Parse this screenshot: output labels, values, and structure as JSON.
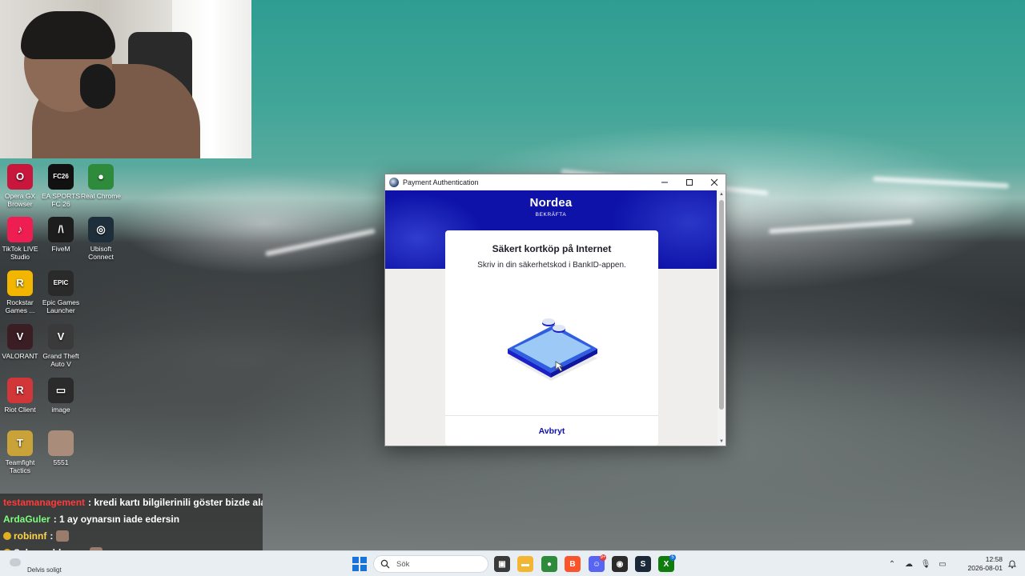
{
  "desktop": {
    "icons": [
      {
        "label": "Opera GX Browser",
        "name": "opera-gx-icon",
        "color": "#c8163c",
        "glyph": "O"
      },
      {
        "label": "EA SPORTS FC 26",
        "name": "ea-fc-icon",
        "color": "#111111",
        "glyph": "FC26"
      },
      {
        "label": "Real Chrome",
        "name": "chrome-icon",
        "color": "#2e8b3b",
        "glyph": "●"
      },
      {
        "label": "TikTok LIVE Studio",
        "name": "tiktok-icon",
        "color": "#ee1d52",
        "glyph": "♪"
      },
      {
        "label": "FiveM",
        "name": "fivem-icon",
        "color": "#1d1d1d",
        "glyph": "/\\"
      },
      {
        "label": "Ubisoft Connect",
        "name": "ubisoft-icon",
        "color": "#1f2e3b",
        "glyph": "◎"
      },
      {
        "label": "Rockstar Games ...",
        "name": "rockstar-icon",
        "color": "#f2b600",
        "glyph": "R"
      },
      {
        "label": "Epic Games Launcher",
        "name": "epic-games-icon",
        "color": "#2a2a2a",
        "glyph": "EPIC"
      },
      {
        "label": "VALORANT",
        "name": "valorant-icon",
        "color": "#3b1d24",
        "glyph": "V"
      },
      {
        "label": "Grand Theft Auto V",
        "name": "gta5-icon",
        "color": "#3a3a3a",
        "glyph": "V"
      },
      {
        "label": "Riot Client",
        "name": "riot-client-icon",
        "color": "#d13639",
        "glyph": "R"
      },
      {
        "label": "image",
        "name": "image-file-icon",
        "color": "#2b2b2b",
        "glyph": "▭"
      },
      {
        "label": "Teamfight Tactics",
        "name": "tft-icon",
        "color": "#caa23a",
        "glyph": "T"
      },
      {
        "label": "5551",
        "name": "photo-file-icon",
        "color": "#a98c79",
        "glyph": ""
      }
    ]
  },
  "chat": {
    "messages": [
      {
        "user": "testamanagement",
        "text": ": kredi kartı bilgilerinili göster bizde alak",
        "color": "#ff3b3b"
      },
      {
        "user": "ArdaGuler",
        "text": ": 1 ay oynarsın iade edersin",
        "color": "#7cff7c"
      },
      {
        "user": "robinnf",
        "text": ":",
        "color": "#ffd54a"
      },
      {
        "user": "Schwarzbleurr",
        "text": ":",
        "color": "#ffffff"
      }
    ]
  },
  "dialog": {
    "title": "Payment Authentication",
    "brand": "Nordea",
    "brand_sub": "BEKRÄFTA",
    "heading": "Säkert kortköp på Internet",
    "instruction": "Skriv in din säkerhetskod i BankID-appen.",
    "cancel_label": "Avbryt",
    "brand_color": "#0e12a8"
  },
  "taskbar": {
    "weather_text": "Delvis soligt",
    "search_placeholder": "Sök",
    "apps": [
      {
        "name": "task-view-icon",
        "color": "#3a3a3a",
        "glyph": "▣",
        "badge": ""
      },
      {
        "name": "file-explorer-icon",
        "color": "#f2b632",
        "glyph": "▬",
        "badge": ""
      },
      {
        "name": "chrome-taskbar-icon",
        "color": "#2e8b3b",
        "glyph": "●",
        "badge": ""
      },
      {
        "name": "brave-icon",
        "color": "#fb542b",
        "glyph": "B",
        "badge": ""
      },
      {
        "name": "discord-icon",
        "color": "#5865f2",
        "glyph": "☺",
        "badge": "9+"
      },
      {
        "name": "obs-icon",
        "color": "#2b2b2b",
        "glyph": "◉",
        "badge": ""
      },
      {
        "name": "steam-icon",
        "color": "#1b2838",
        "glyph": "S",
        "badge": ""
      },
      {
        "name": "xbox-icon",
        "color": "#107c10",
        "glyph": "X",
        "badge": "5"
      }
    ],
    "tray": [
      {
        "name": "chevron-up-icon",
        "glyph": "⌃"
      },
      {
        "name": "cloud-off-icon",
        "glyph": "☁"
      },
      {
        "name": "microphone-icon",
        "glyph": "🎙"
      },
      {
        "name": "monitor-icon",
        "glyph": "▭"
      },
      {
        "name": "wifi-icon",
        "glyph": "⌔"
      },
      {
        "name": "speaker-icon",
        "glyph": "🔊"
      }
    ],
    "time": "12:58",
    "date": "2026-08-01"
  }
}
